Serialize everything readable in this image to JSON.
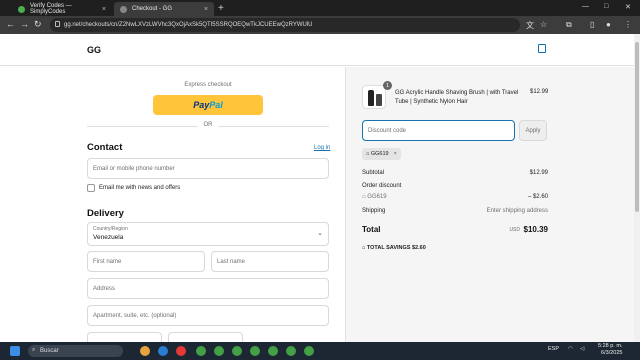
{
  "browser": {
    "tabs": [
      {
        "label": "Verify Codes — SimplyCodes",
        "active": false
      },
      {
        "label": "Checkout - GG",
        "active": true
      }
    ],
    "url": "gg.net/checkouts/cn/Z2NwLXVzLWVhc3QxOjAxSk5QTI5SSRQOEQwTkJCUEEwQzRYWUlU"
  },
  "store": {
    "name": "GG"
  },
  "checkout": {
    "express_label": "Express checkout",
    "paypal_p1": "Pay",
    "paypal_p2": "Pal",
    "or_label": "OR",
    "contact_heading": "Contact",
    "login_link": "Log in",
    "email_placeholder": "Email or mobile phone number",
    "email_news_label": "Email me with news and offers",
    "delivery_heading": "Delivery",
    "country_label": "Country/Region",
    "country_value": "Venezuela",
    "first_name_placeholder": "First name",
    "last_name_placeholder": "Last name",
    "address_placeholder": "Address",
    "apartment_placeholder": "Apartment, suite, etc. (optional)"
  },
  "summary": {
    "product_qty": "1",
    "product_name": "GG Acrylic Handle Shaving Brush | with Travel Tube | Synthetic Nylon Hair",
    "product_price": "$12.99",
    "discount_placeholder": "Discount code",
    "apply_label": "Apply",
    "applied_code": "GG619",
    "subtotal_label": "Subtotal",
    "subtotal_value": "$12.99",
    "order_discount_label": "Order discount",
    "discount_code": "GG619",
    "discount_value": "– $2.60",
    "shipping_label": "Shipping",
    "shipping_value": "Enter shipping address",
    "total_label": "Total",
    "total_currency": "USD",
    "total_value": "$10.39",
    "savings_label": "TOTAL SAVINGS",
    "savings_value": "$2.60"
  },
  "taskbar": {
    "search_label": "Buscar",
    "lang": "ESP",
    "time": "5:28 p. m.",
    "date": "6/3/2025"
  },
  "colors": {
    "accent": "#1773b0",
    "paypal": "#ffc439"
  }
}
